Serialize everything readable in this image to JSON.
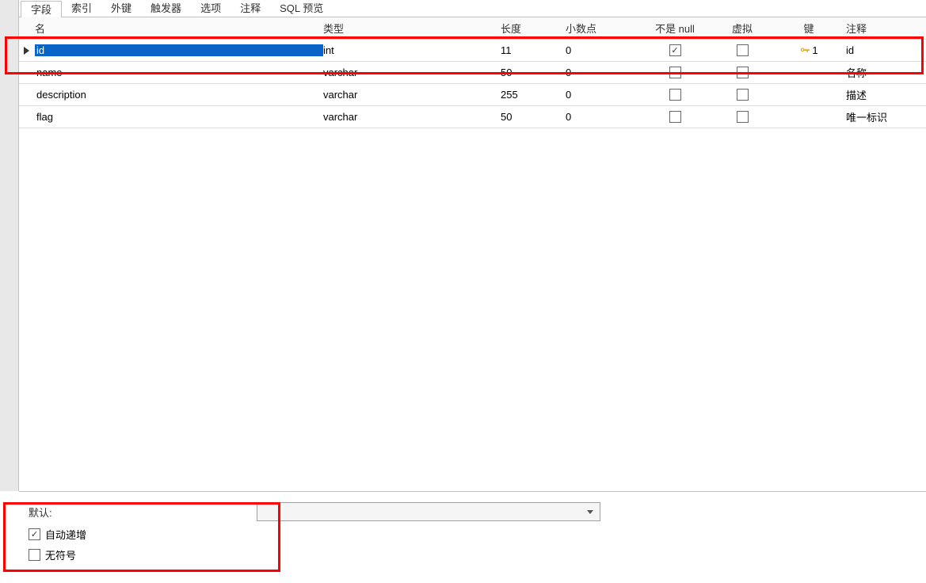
{
  "tabs": {
    "fields": "字段",
    "indexes": "索引",
    "foreignKeys": "外键",
    "triggers": "触发器",
    "options": "选项",
    "comment": "注释",
    "sqlPreview": "SQL 预览"
  },
  "headers": {
    "name": "名",
    "type": "类型",
    "length": "长度",
    "decimal": "小数点",
    "notNull": "不是 null",
    "virtual": "虚拟",
    "key": "键",
    "comment": "注释"
  },
  "rows": [
    {
      "name": "id",
      "type": "int",
      "length": "11",
      "decimal": "0",
      "notNull": true,
      "virtual": false,
      "keyNum": "1",
      "comment": "id",
      "selected": true
    },
    {
      "name": "name",
      "type": "varchar",
      "length": "50",
      "decimal": "0",
      "notNull": false,
      "virtual": false,
      "keyNum": "",
      "comment": "名称",
      "selected": false
    },
    {
      "name": "description",
      "type": "varchar",
      "length": "255",
      "decimal": "0",
      "notNull": false,
      "virtual": false,
      "keyNum": "",
      "comment": "描述",
      "selected": false
    },
    {
      "name": "flag",
      "type": "varchar",
      "length": "50",
      "decimal": "0",
      "notNull": false,
      "virtual": false,
      "keyNum": "",
      "comment": "唯一标识",
      "selected": false
    }
  ],
  "bottom": {
    "defaultLabel": "默认:",
    "defaultValue": "",
    "autoIncrement": "自动递增",
    "autoIncrementChecked": true,
    "unsigned": "无符号",
    "unsignedChecked": false
  }
}
